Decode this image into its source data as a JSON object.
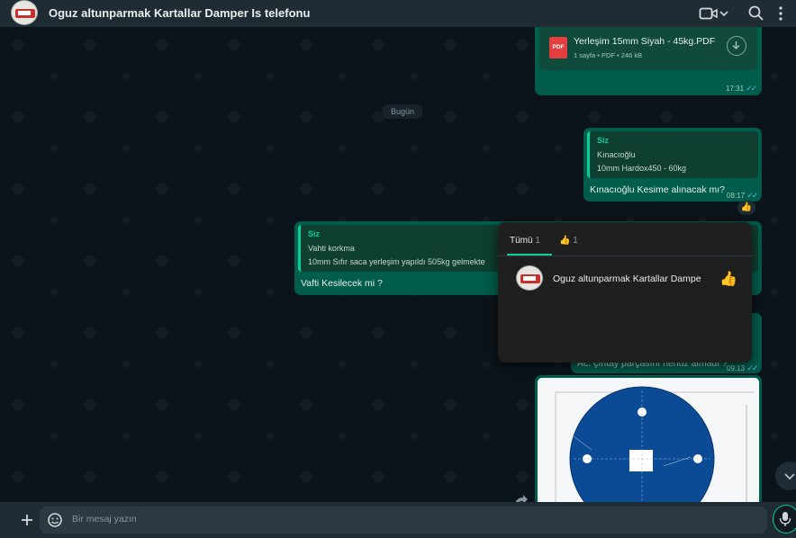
{
  "header": {
    "title": "Oguz altunparmak Kartallar Damper Is telefonu"
  },
  "chat": {
    "pdf_message": {
      "filename": "Yerleşim 15mm Siyah - 45kg.PDF",
      "meta": "1 sayfa • PDF • 246 kB",
      "pdf_badge": "PDF",
      "time": "17:31"
    },
    "date_divider": "Bugün",
    "msg1": {
      "quote_author": "Siz",
      "quote_line1": "Kınacıoğlu",
      "quote_line2": "10mm Hardox450 - 60kg",
      "text": "Kınacıoğlu Kesime alınacak mı?",
      "time": "08:17",
      "reaction": "👍"
    },
    "msg2": {
      "quote_author": "Siz",
      "quote_line1": "Vahti korkma",
      "quote_line2": "10mm Sıfır saca yerleşim yapıldı 505kg gelmekte",
      "text": "Vafti Kesilecek mi ?"
    },
    "msg3": {
      "text": "Ac. çıntay parçasını henüz almadı ?",
      "time": "09:13"
    }
  },
  "reaction_popup": {
    "tab_all_label": "Tümü",
    "tab_all_count": "1",
    "tab_thumb_emoji": "👍",
    "tab_thumb_count": "1",
    "reactor_name": "Oguz altunparmak Kartallar Dampe",
    "reactor_emoji": "👍"
  },
  "input": {
    "placeholder": "Bir mesaj yazın"
  },
  "colors": {
    "accent": "#06cf9c",
    "outgoing_bubble": "#005c4b",
    "background": "#0b141a"
  }
}
